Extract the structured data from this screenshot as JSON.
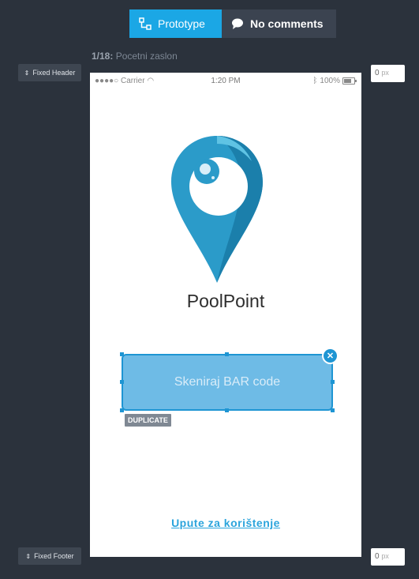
{
  "tabs": {
    "prototype_label": "Prototype",
    "comments_label": "No comments"
  },
  "screen": {
    "index": "1/18:",
    "name": "Pocetni zaslon"
  },
  "controls": {
    "fixed_header_label": "Fixed Header",
    "fixed_footer_label": "Fixed Footer",
    "header_offset_value": "0",
    "footer_offset_value": "0",
    "unit": "px"
  },
  "statusbar": {
    "carrier": "Carrier",
    "time": "1:20 PM",
    "battery": "100%"
  },
  "app": {
    "brand": "PoolPoint",
    "scan_button_label": "Skeniraj BAR code",
    "duplicate_tag": "DUPLICATE",
    "help_link": "Upute za korištenje"
  },
  "colors": {
    "accent": "#1ba7e5",
    "background": "#2b323c",
    "scan_fill": "#6ebbe6",
    "link": "#2ba4dc"
  },
  "icons": {
    "prototype": "prototype-link-icon",
    "comments": "speech-bubble-icon",
    "close": "close-icon"
  }
}
